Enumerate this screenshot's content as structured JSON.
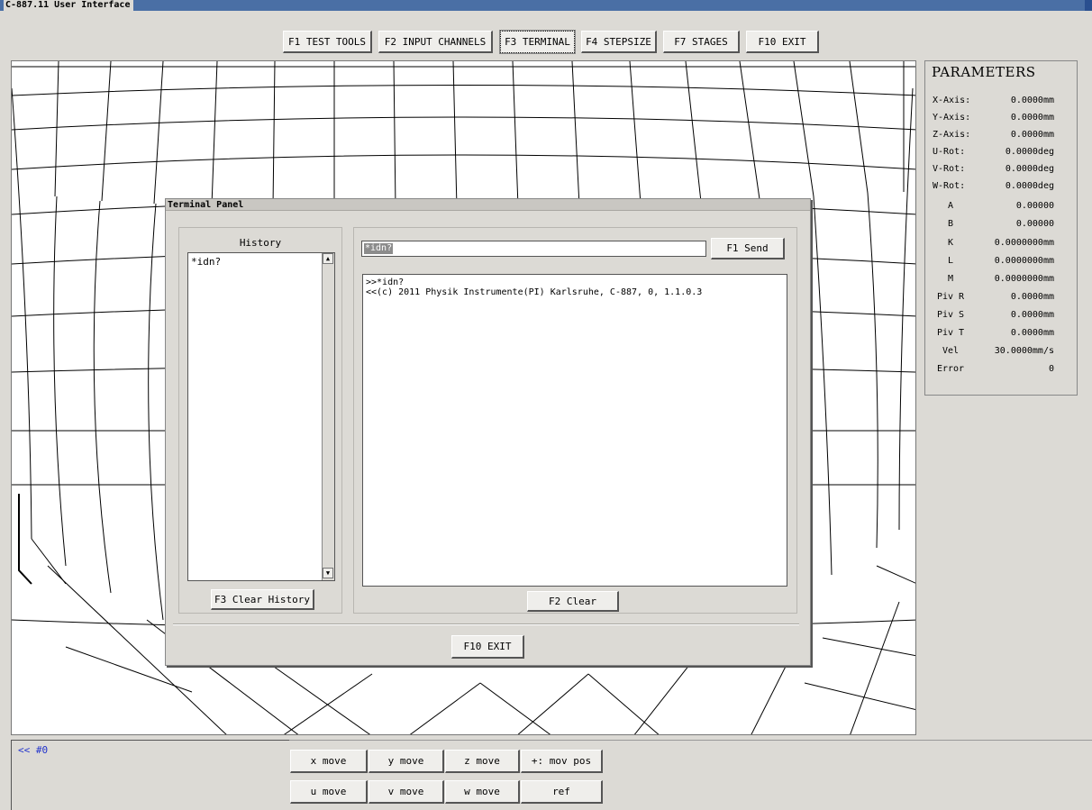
{
  "window": {
    "title": "C-887.11 User Interface"
  },
  "toolbar": {
    "buttons": [
      {
        "label": "F1 TEST TOOLS"
      },
      {
        "label": "F2 INPUT CHANNELS"
      },
      {
        "label": "F3 TERMINAL"
      },
      {
        "label": "F4 STEPSIZE"
      },
      {
        "label": "F7 STAGES"
      },
      {
        "label": "F10 EXIT"
      }
    ]
  },
  "parameters": {
    "title": "PARAMETERS",
    "rows": [
      {
        "label": "X-Axis:",
        "value": "0.0000mm"
      },
      {
        "label": "Y-Axis:",
        "value": "0.0000mm"
      },
      {
        "label": "Z-Axis:",
        "value": "0.0000mm"
      },
      {
        "label": "U-Rot:",
        "value": "0.0000deg"
      },
      {
        "label": "V-Rot:",
        "value": "0.0000deg"
      },
      {
        "label": "W-Rot:",
        "value": "0.0000deg"
      },
      {
        "label": "A",
        "value": "0.00000"
      },
      {
        "label": "B",
        "value": "0.00000"
      },
      {
        "label": "K",
        "value": "0.0000000mm"
      },
      {
        "label": "L",
        "value": "0.0000000mm"
      },
      {
        "label": "M",
        "value": "0.0000000mm"
      },
      {
        "label": "Piv R",
        "value": "0.0000mm"
      },
      {
        "label": "Piv S",
        "value": "0.0000mm"
      },
      {
        "label": "Piv T",
        "value": "0.0000mm"
      },
      {
        "label": "Vel",
        "value": "30.0000mm/s"
      },
      {
        "label": "Error",
        "value": "0"
      }
    ]
  },
  "terminal_panel": {
    "title": "Terminal Panel",
    "history": {
      "title": "History",
      "items": [
        "*idn?"
      ],
      "clear_label": "F3 Clear History"
    },
    "command": {
      "value": "*idn?",
      "send_label": "F1 Send"
    },
    "output": {
      "lines": [
        ">>*idn?",
        "<<(c) 2011 Physik Instrumente(PI) Karlsruhe, C-887, 0, 1.1.0.3"
      ],
      "clear_label": "F2 Clear"
    },
    "exit_label": "F10 EXIT"
  },
  "status": {
    "text": "<< #0"
  },
  "move_buttons": {
    "row1": [
      {
        "label": "x move"
      },
      {
        "label": "y move"
      },
      {
        "label": "z move"
      },
      {
        "label": "+: mov pos"
      }
    ],
    "row2": [
      {
        "label": "u move"
      },
      {
        "label": "v move"
      },
      {
        "label": "w move"
      },
      {
        "label": "ref"
      }
    ]
  },
  "icons": {
    "scroll_up": "scroll-up-arrow-icon",
    "scroll_down": "scroll-down-arrow-icon"
  },
  "colors": {
    "titlebar": "#4a6fa5",
    "background": "#dcdad5",
    "status_text": "#2233cc",
    "selection": "#8c8c8c"
  }
}
